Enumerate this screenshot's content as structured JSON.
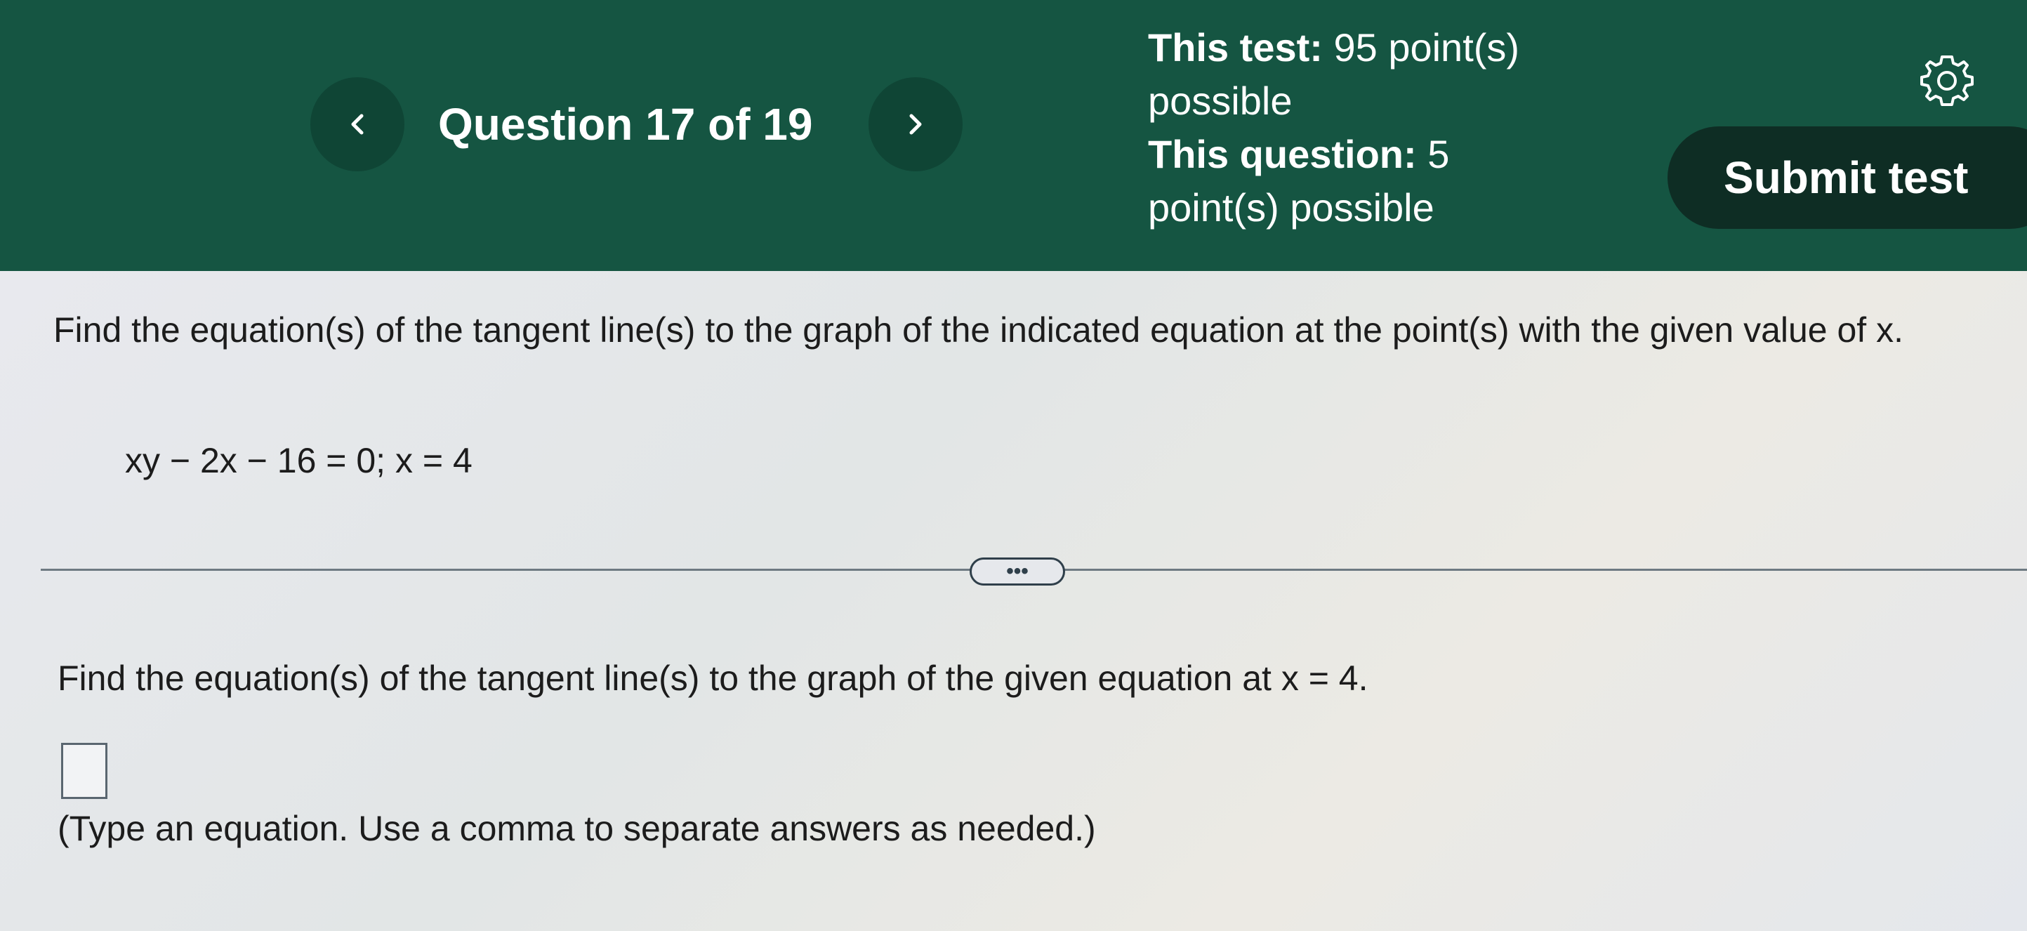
{
  "header": {
    "question_counter": "Question 17 of 19",
    "test_points_label": "This test:",
    "test_points_value": " 95 point(s)",
    "test_points_suffix": "possible",
    "question_points_label": "This question:",
    "question_points_value": " 5",
    "question_points_suffix": "point(s) possible",
    "submit_label": "Submit test",
    "prev_icon": "chevron-left-icon",
    "next_icon": "chevron-right-icon",
    "settings_icon": "gear-icon"
  },
  "question": {
    "instruction": "Find the equation(s) of the tangent line(s) to the graph of the indicated equation at the point(s) with the given value of x.",
    "equation": "xy − 2x − 16 = 0; x = 4",
    "more_label": "•••",
    "prompt": "Find the equation(s) of the tangent line(s) to the graph of the given equation at x = 4.",
    "answer_value": "",
    "hint": "(Type an equation. Use a comma to separate answers as needed.)"
  },
  "colors": {
    "header_bg": "#155542",
    "nav_button_bg": "#0f4535",
    "submit_bg": "#0e2d24",
    "content_bg": "#e4e6ea",
    "text": "#1c1c1c"
  }
}
